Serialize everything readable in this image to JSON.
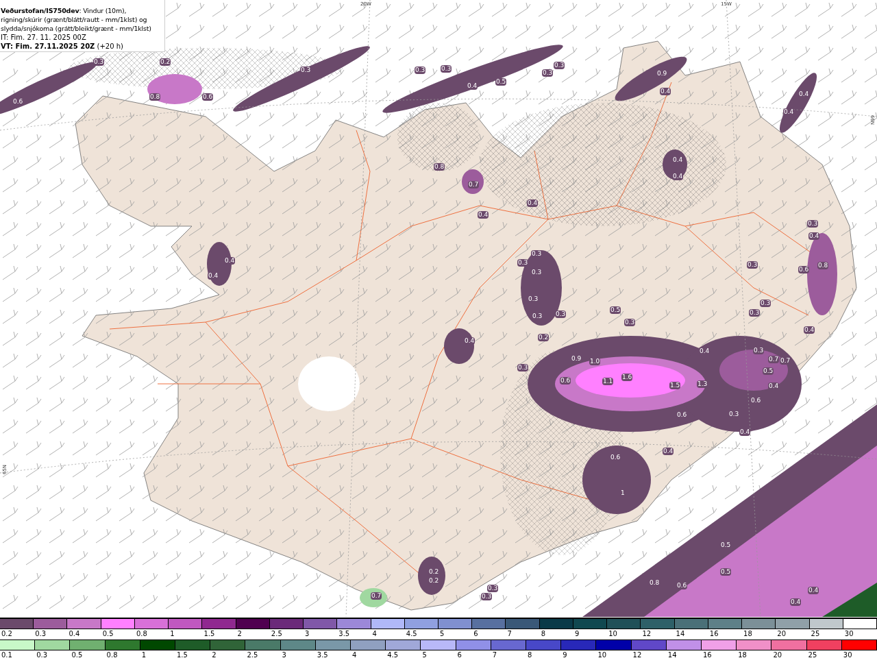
{
  "header": {
    "title": "**Veðurstofan/IS750dev**: Vindur (10m), rigning/skúrir (grænt/blátt/rautt - mm/1klst) og slydda/snjókoma (grátt/bleikt/grænt - mm/1klst)",
    "init_time": "IT: Fim. 27. 11. 2025 00Z",
    "valid_time": "**VT: Fim. 27.11.2025 20Z** (+20 h)"
  },
  "grid_labels": [
    "20W",
    "15W",
    "66N",
    "65N"
  ],
  "map_values": [
    "0.3",
    "0.2",
    "0.6",
    "0.8",
    "0.6",
    "0.3",
    "0.3",
    "0.3",
    "0.4",
    "0.5",
    "0.3",
    "0.3",
    "0.9",
    "0.4",
    "0.4",
    "0.4",
    "0.4",
    "0.4",
    "0.8",
    "0.7",
    "0.4",
    "0.4",
    "0.4",
    "0.4",
    "0.3",
    "0.3",
    "0.3",
    "0.3",
    "0.3",
    "0.4",
    "0.6",
    "0.8",
    "0.3",
    "0.3",
    "0.3",
    "0.5",
    "0.3",
    "0.2",
    "0.4",
    "0.3",
    "0.3",
    "0.4",
    "0.4",
    "0.3",
    "0.7",
    "0.7",
    "0.5",
    "0.3",
    "0.9",
    "1.0",
    "0.6",
    "1.1",
    "1.6",
    "1.5",
    "1.3",
    "0.6",
    "0.4",
    "0.6",
    "0.3",
    "0.4",
    "0.4",
    "0.6",
    "1",
    "0.5",
    "0.5",
    "0.8",
    "0.6",
    "0.4",
    "0.4",
    "0.2",
    "0.2",
    "0.3",
    "0.3",
    "0.7"
  ],
  "snow_legend": [
    {
      "label": "0.2",
      "color": "#6b4a6b"
    },
    {
      "label": "0.3",
      "color": "#9c5c9c"
    },
    {
      "label": "0.4",
      "color": "#c878c8"
    },
    {
      "label": "0.5",
      "color": "#ff80ff"
    },
    {
      "label": "0.8",
      "color": "#d870d8"
    },
    {
      "label": "1",
      "color": "#c058c0"
    },
    {
      "label": "1.5",
      "color": "#902890"
    },
    {
      "label": "2",
      "color": "#500050"
    },
    {
      "label": "2.5",
      "color": "#6b2a7a"
    },
    {
      "label": "3",
      "color": "#8058a8"
    },
    {
      "label": "3.5",
      "color": "#9c88d8"
    },
    {
      "label": "4",
      "color": "#b0b8f8"
    },
    {
      "label": "4.5",
      "color": "#90a0e0"
    },
    {
      "label": "5",
      "color": "#8090d0"
    },
    {
      "label": "6",
      "color": "#5870a0"
    },
    {
      "label": "7",
      "color": "#3a5878"
    },
    {
      "label": "8",
      "color": "#0a3a48"
    },
    {
      "label": "9",
      "color": "#104850"
    },
    {
      "label": "10",
      "color": "#205058"
    },
    {
      "label": "12",
      "color": "#2e6068"
    },
    {
      "label": "14",
      "color": "#4a7078"
    },
    {
      "label": "16",
      "color": "#5e8088"
    },
    {
      "label": "18",
      "color": "#7c9098"
    },
    {
      "label": "20",
      "color": "#90a0a8"
    },
    {
      "label": "25",
      "color": "#c0c8cc"
    },
    {
      "label": "30",
      "color": "#ffffff"
    }
  ],
  "rain_legend": [
    {
      "label": "0.1",
      "color": "#c8f8c8"
    },
    {
      "label": "0.3",
      "color": "#a0d8a0"
    },
    {
      "label": "0.5",
      "color": "#70b070"
    },
    {
      "label": "0.8",
      "color": "#2e782e"
    },
    {
      "label": "1",
      "color": "#004800"
    },
    {
      "label": "1.5",
      "color": "#1e5c28"
    },
    {
      "label": "2",
      "color": "#306438"
    },
    {
      "label": "2.5",
      "color": "#4a7a68"
    },
    {
      "label": "3",
      "color": "#5e8888"
    },
    {
      "label": "3.5",
      "color": "#7a98a8"
    },
    {
      "label": "4",
      "color": "#90a0c0"
    },
    {
      "label": "4.5",
      "color": "#a0a8d8"
    },
    {
      "label": "5",
      "color": "#b8b8f8"
    },
    {
      "label": "6",
      "color": "#9090e8"
    },
    {
      "label": "7",
      "color": "#6868d0"
    },
    {
      "label": "8",
      "color": "#4848c8"
    },
    {
      "label": "9",
      "color": "#2828b8"
    },
    {
      "label": "10",
      "color": "#0000a8"
    },
    {
      "label": "12",
      "color": "#6048c8"
    },
    {
      "label": "14",
      "color": "#c090e8"
    },
    {
      "label": "16",
      "color": "#f0a0e8"
    },
    {
      "label": "18",
      "color": "#f090c8"
    },
    {
      "label": "20",
      "color": "#f070a0"
    },
    {
      "label": "25",
      "color": "#f04060"
    },
    {
      "label": "30",
      "color": "#ff0000"
    }
  ]
}
